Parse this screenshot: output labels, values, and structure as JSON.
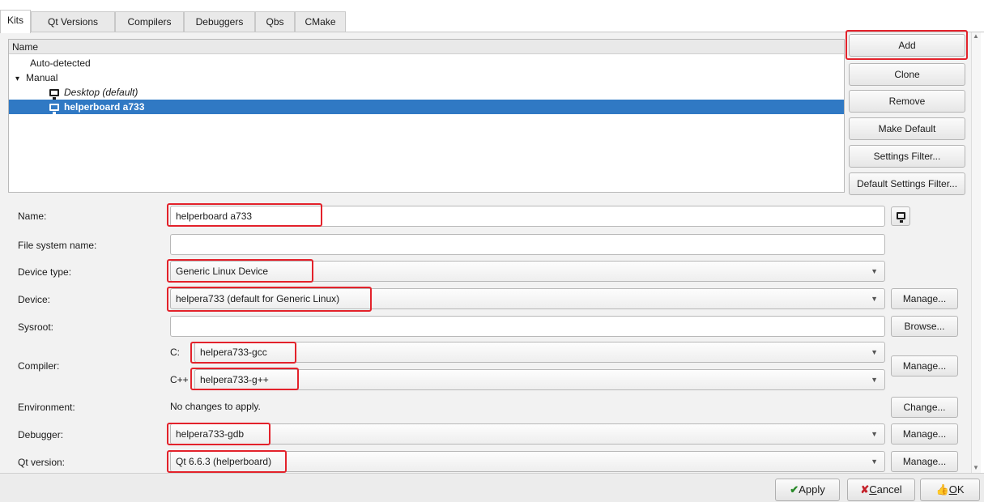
{
  "tabs": [
    "Kits",
    "Qt Versions",
    "Compilers",
    "Debuggers",
    "Qbs",
    "CMake"
  ],
  "kit_list": {
    "header": "Name",
    "auto_detected": "Auto-detected",
    "manual": "Manual",
    "manual_expand_glyph": "▾",
    "kits": [
      "Desktop (default)",
      "helperboard a733"
    ],
    "selected_kit": "helperboard a733"
  },
  "side_buttons": {
    "add": "Add",
    "clone": "Clone",
    "remove": "Remove",
    "make_default": "Make Default",
    "settings_filter": "Settings Filter...",
    "default_settings_filter": "Default Settings Filter..."
  },
  "form": {
    "name_label": "Name:",
    "name_value": "helperboard a733",
    "fs_name_label": "File system name:",
    "fs_name_value": "",
    "device_type_label": "Device type:",
    "device_type_value": "Generic Linux Device",
    "device_label": "Device:",
    "device_value": "helpera733 (default for Generic Linux)",
    "device_manage": "Manage...",
    "sysroot_label": "Sysroot:",
    "sysroot_value": "",
    "sysroot_browse": "Browse...",
    "compiler_label": "Compiler:",
    "compiler_c_label": "C:",
    "compiler_c_value": "helpera733-gcc",
    "compiler_cpp_label": "C++",
    "compiler_cpp_value": "helpera733-g++",
    "compiler_manage": "Manage...",
    "env_label": "Environment:",
    "env_value": "No changes to apply.",
    "env_change": "Change...",
    "debugger_label": "Debugger:",
    "debugger_value": "helpera733-gdb",
    "debugger_manage": "Manage...",
    "qt_version_label": "Qt version:",
    "qt_version_value": "Qt 6.6.3 (helperboard)",
    "qt_version_manage": "Manage..."
  },
  "dialog_buttons": {
    "apply": "Apply",
    "cancel": "Cancel",
    "ok": "OK",
    "cancel_mnemonic": "C",
    "cancel_rest": "ancel",
    "ok_mnemonic": "O",
    "ok_rest": "K"
  },
  "colors": {
    "selection": "#3079c4",
    "highlight_box": "#e3222b"
  }
}
